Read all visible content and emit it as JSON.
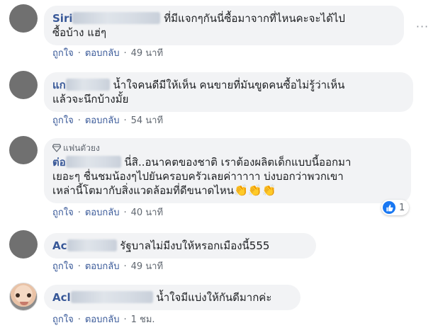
{
  "comments": [
    {
      "author": "Siri",
      "text_line1": "ที่มีแจกๆกันนี่ซื้อมาจากที่ไหนคะจะได้ไป",
      "text_line2": "ซื้อบ้าง แฮ่ๆ",
      "like_label": "ถูกใจ",
      "reply_label": "ตอบกลับ",
      "time": "49 นาที"
    },
    {
      "author": "แก",
      "text_line1": "น้ำใจคนดีมีให้เห็น คนขายที่มันขูดคนซื้อไม่รู้ว่าเห็น",
      "text_line2": "แล้วจะนึกบ้างมั้ย",
      "like_label": "ถูกใจ",
      "reply_label": "ตอบกลับ",
      "time": "54 นาที"
    },
    {
      "badge": "แฟนตัวยง",
      "author": "ต่อ",
      "text_line1": "นี่สิ..อนาคตของชาติ เราต้องผลิตเด็กแบบนี้ออกมา",
      "text_line2": "เยอะๆ ชื่นชมน้องๆไปยันครอบครัวเลยค่าาาาา บ่งบอกว่าพวกเขา",
      "text_line3": "เหล่านี้โตมากับสิ่งแวดล้อมที่ดีขนาดไหน",
      "emoji": "👏👏👏",
      "like_label": "ถูกใจ",
      "reply_label": "ตอบกลับ",
      "time": "40 นาที",
      "reaction_count": "1"
    },
    {
      "author": "Ac",
      "text_line1": "รัฐบาลไม่มีงบให้หรอกเมืองนี้555",
      "like_label": "ถูกใจ",
      "reply_label": "ตอบกลับ",
      "time": "49 นาที"
    },
    {
      "author": "Acl",
      "text_line1": "น้ำใจมีแบ่งให้กันดีมากค่ะ",
      "like_label": "ถูกใจ",
      "reply_label": "ตอบกลับ",
      "time": "1 ชม."
    }
  ],
  "more_icon": "more-horizontal-icon",
  "colors": {
    "author": "#385898",
    "bubble": "#f2f3f5",
    "meta": "#606770",
    "like": "#1877f2"
  }
}
